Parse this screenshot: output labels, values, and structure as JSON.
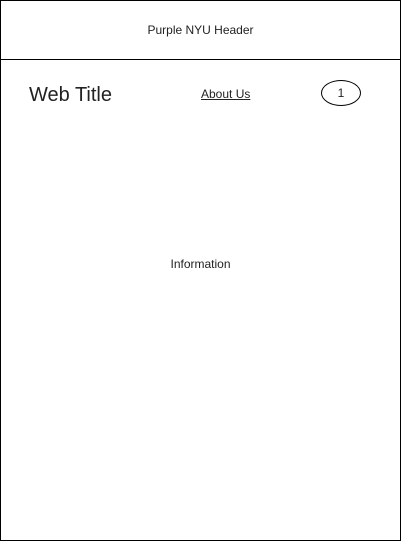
{
  "header": {
    "label": "Purple NYU Header"
  },
  "nav": {
    "title": "Web Title",
    "about_link": "About Us",
    "badge_value": "1"
  },
  "main": {
    "content_label": "Information"
  }
}
